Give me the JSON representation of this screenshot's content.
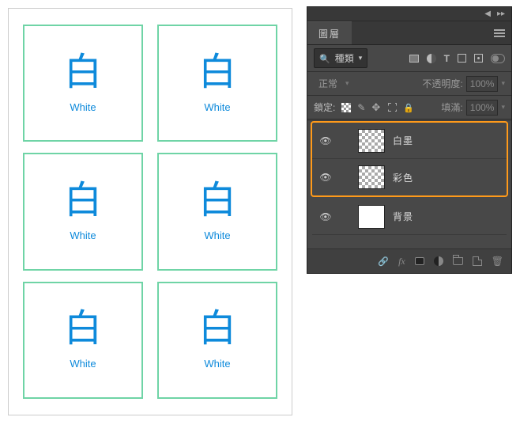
{
  "canvas": {
    "cells": [
      {
        "glyph": "白",
        "sub": "White"
      },
      {
        "glyph": "白",
        "sub": "White"
      },
      {
        "glyph": "白",
        "sub": "White"
      },
      {
        "glyph": "白",
        "sub": "White"
      },
      {
        "glyph": "白",
        "sub": "White"
      },
      {
        "glyph": "白",
        "sub": "White"
      }
    ]
  },
  "panel": {
    "tab_label": "圖層",
    "kind_label": "種類",
    "blend_mode": "正常",
    "opacity_label": "不透明度:",
    "opacity_value": "100%",
    "lock_label": "鎖定:",
    "fill_label": "填滿:",
    "fill_value": "100%",
    "layers": [
      {
        "name": "白墨",
        "thumb": "trans"
      },
      {
        "name": "彩色",
        "thumb": "trans"
      },
      {
        "name": "背景",
        "thumb": "white"
      }
    ],
    "fx_label": "fx",
    "t_label": "T"
  }
}
